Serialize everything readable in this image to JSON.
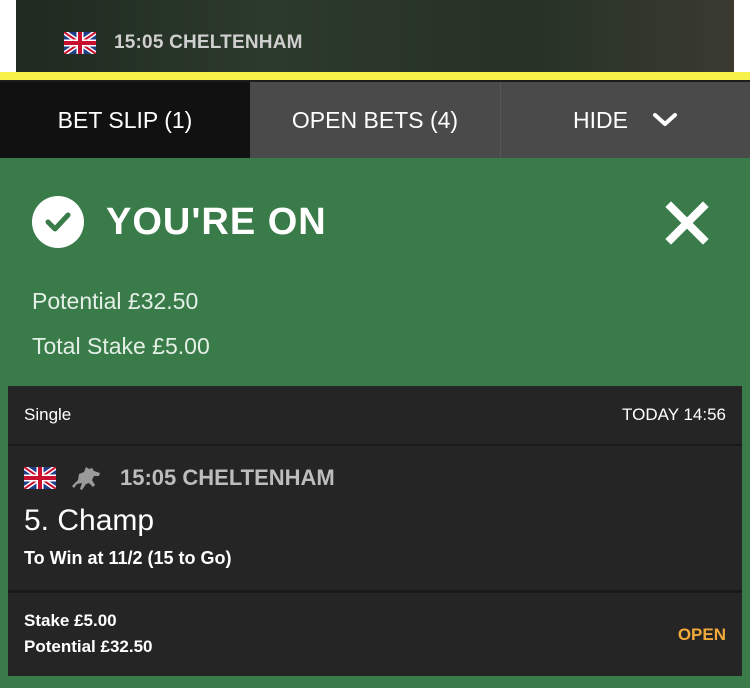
{
  "top_race": {
    "flag_icon": "uk-flag-icon",
    "label": "15:05  CHELTENHAM"
  },
  "tabs": {
    "bet_slip": "BET SLIP (1)",
    "open_bets": "OPEN BETS (4)",
    "hide": "HIDE",
    "hide_icon": "chevron-down-icon"
  },
  "confirmation": {
    "icon": "check-circle-icon",
    "title": "YOU'RE ON",
    "close_icon": "close-icon",
    "potential": "Potential  £32.50",
    "total_stake": "Total Stake  £5.00"
  },
  "bet": {
    "type": "Single",
    "placed_time": "TODAY 14:56",
    "flag_icon": "uk-flag-icon",
    "sport_icon": "horse-racing-icon",
    "race": "15:05 CHELTENHAM",
    "selection": "5. Champ",
    "market": "To Win at 11/2 (15 to Go)",
    "stake": "Stake £5.00",
    "potential": "Potential £32.50",
    "status": "OPEN"
  },
  "colors": {
    "confirm_green": "#3a7b4a",
    "accent_yellow": "#f6f24a",
    "status_orange": "#f1a93a",
    "card_bg": "#252525"
  }
}
